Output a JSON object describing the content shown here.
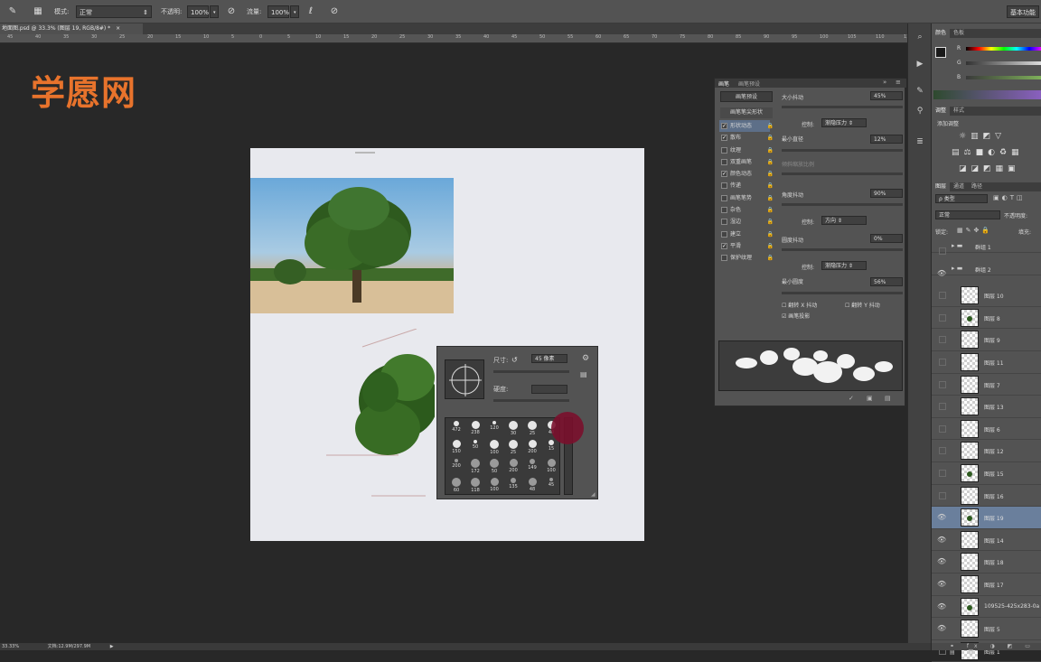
{
  "options_bar": {
    "mode_label": "模式:",
    "mode_value": "正常",
    "opacity_label": "不透明:",
    "opacity_value": "100%",
    "flow_label": "流量:",
    "flow_value": "100%",
    "workspace_button": "基本功能"
  },
  "document_tab": {
    "title": "地面图.psd @ 33.3% (图层 19, RGB/8#) *",
    "close": "×"
  },
  "ruler": {
    "ticks": [
      "45",
      "40",
      "35",
      "30",
      "25",
      "20",
      "15",
      "10",
      "5",
      "0",
      "5",
      "10",
      "15",
      "20",
      "25",
      "30",
      "35",
      "40",
      "45",
      "50",
      "55",
      "60",
      "65",
      "70",
      "75",
      "80",
      "85",
      "90",
      "95",
      "100",
      "105",
      "110",
      "115"
    ]
  },
  "logo": {
    "text": "学愿网"
  },
  "brush_picker": {
    "size_label": "尺寸:",
    "size_value": "45 像素",
    "hardness_label": "硬度:",
    "brushes": [
      [
        "472",
        "238",
        "120",
        "30",
        "25",
        "40"
      ],
      [
        "150",
        "50",
        "100",
        "25",
        "200",
        "15"
      ],
      [
        "200",
        "172",
        "50",
        "200",
        "149",
        "100"
      ],
      [
        "60",
        "118",
        "100",
        "135",
        "48",
        "45"
      ]
    ]
  },
  "brush_panel": {
    "tabs": [
      "画笔",
      "画笔预设"
    ],
    "preset_button": "画笔预设",
    "shape_header": "画笔笔尖形状",
    "options": [
      {
        "label": "形状动态",
        "checked": true,
        "selected": true
      },
      {
        "label": "散布",
        "checked": true,
        "selected": false
      },
      {
        "label": "纹理",
        "checked": false,
        "selected": false
      },
      {
        "label": "双重画笔",
        "checked": false,
        "selected": false
      },
      {
        "label": "颜色动态",
        "checked": true,
        "selected": false
      },
      {
        "label": "传递",
        "checked": false,
        "selected": false
      },
      {
        "label": "画笔笔势",
        "checked": false,
        "selected": false
      },
      {
        "label": "杂色",
        "checked": false,
        "selected": false
      },
      {
        "label": "湿边",
        "checked": false,
        "selected": false
      },
      {
        "label": "建立",
        "checked": false,
        "selected": false
      },
      {
        "label": "平滑",
        "checked": true,
        "selected": false
      },
      {
        "label": "保护纹理",
        "checked": false,
        "selected": false
      }
    ],
    "size_jitter_label": "大小抖动",
    "size_jitter_value": "45%",
    "control_label": "控制:",
    "control_value_1": "渐隐压力",
    "min_diameter_label": "最小直径",
    "min_diameter_value": "12%",
    "tilt_scale_label": "倾斜缩放比例",
    "angle_jitter_label": "角度抖动",
    "angle_jitter_value": "90%",
    "control_value_2": "方向",
    "roundness_jitter_label": "圆度抖动",
    "roundness_jitter_value": "0%",
    "control_value_3": "渐隐压力",
    "min_roundness_label": "最小圆度",
    "min_roundness_value": "56%",
    "flip_x_label": "翻转 X 抖动",
    "flip_y_label": "翻转 Y 抖动",
    "brush_projection_label": "画笔投影"
  },
  "color_panel": {
    "tabs": [
      "颜色",
      "色板"
    ],
    "channels": [
      "R",
      "G",
      "B"
    ]
  },
  "adjust_panel": {
    "tabs": [
      "调整",
      "样式"
    ],
    "title": "添加调整"
  },
  "layers_panel": {
    "tabs": [
      "图层",
      "通道",
      "路径"
    ],
    "filter_value": "ρ 类型",
    "blend_value": "正常",
    "opacity_label": "不透明度:",
    "lock_label": "锁定:",
    "fill_label": "填充:",
    "layers": [
      {
        "name": "群组 1",
        "visible": false,
        "type": "group",
        "selected": false
      },
      {
        "name": "群组 2",
        "visible": true,
        "type": "group",
        "selected": false
      },
      {
        "name": "图层 10",
        "visible": false,
        "type": "layer",
        "selected": false,
        "tree": false
      },
      {
        "name": "图层 8",
        "visible": false,
        "type": "layer",
        "selected": false,
        "tree": true
      },
      {
        "name": "图层 9",
        "visible": false,
        "type": "layer",
        "selected": false,
        "tree": false
      },
      {
        "name": "图层 11",
        "visible": false,
        "type": "layer",
        "selected": false,
        "tree": false
      },
      {
        "name": "图层 7",
        "visible": false,
        "type": "layer",
        "selected": false,
        "tree": false
      },
      {
        "name": "图层 13",
        "visible": false,
        "type": "layer",
        "selected": false,
        "tree": false
      },
      {
        "name": "图层 6",
        "visible": false,
        "type": "layer",
        "selected": false,
        "tree": false
      },
      {
        "name": "图层 12",
        "visible": false,
        "type": "layer",
        "selected": false,
        "tree": false
      },
      {
        "name": "图层 15",
        "visible": false,
        "type": "layer",
        "selected": false,
        "tree": true
      },
      {
        "name": "图层 16",
        "visible": false,
        "type": "layer",
        "selected": false,
        "tree": false
      },
      {
        "name": "图层 19",
        "visible": true,
        "type": "layer",
        "selected": true,
        "tree": true
      },
      {
        "name": "图层 14",
        "visible": true,
        "type": "layer",
        "selected": false,
        "tree": false
      },
      {
        "name": "图层 18",
        "visible": true,
        "type": "layer",
        "selected": false,
        "tree": false
      },
      {
        "name": "图层 17",
        "visible": true,
        "type": "layer",
        "selected": false,
        "tree": false
      },
      {
        "name": "109525-425x283-0a",
        "visible": true,
        "type": "layer",
        "selected": false,
        "tree": true
      },
      {
        "name": "图层 5",
        "visible": true,
        "type": "layer",
        "selected": false,
        "tree": false
      },
      {
        "name": "图层 1",
        "visible": false,
        "type": "layer",
        "selected": false,
        "tree": false
      }
    ]
  },
  "status_bar": {
    "zoom": "33.33%",
    "doc_label": "文档:12.9M/297.9M"
  }
}
